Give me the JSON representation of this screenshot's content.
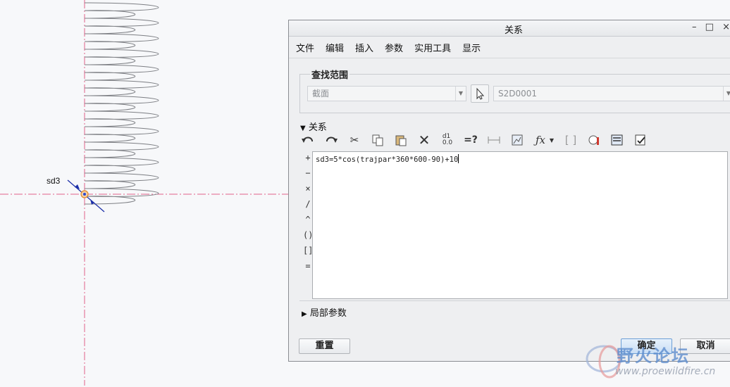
{
  "canvas": {
    "dimension_label": "sd3"
  },
  "dialog": {
    "title": "关系",
    "window_controls": [
      "–",
      "□",
      "×"
    ],
    "menu": [
      "文件",
      "编辑",
      "插入",
      "参数",
      "实用工具",
      "显示"
    ],
    "search_scope": {
      "title": "查找范围",
      "type_value": "截面",
      "item_value": "S2D0001"
    },
    "relations": {
      "header": "关系",
      "toolbar": [
        "undo-icon",
        "redo-icon",
        "cut-icon",
        "copy-icon",
        "paste-icon",
        "delete-icon",
        "switch-dimensions-icon",
        "evaluate-icon",
        "measure-icon",
        "mass-properties-icon",
        "function-icon",
        "dropdown-icon",
        "bracket-icon",
        "parameters-icon",
        "sort-relations-icon",
        "verify-relations-icon"
      ],
      "operators": [
        "+",
        "−",
        "×",
        "/",
        "^",
        "()",
        "[]",
        "="
      ],
      "text": "sd3=5*cos(trajpar*360*600-90)+10"
    },
    "local_params": "局部参数",
    "buttons": {
      "reset": "重置",
      "ok": "确定",
      "cancel": "取消"
    }
  },
  "watermark": {
    "title": "野火论坛",
    "url": "www.proewildfire.cn"
  }
}
